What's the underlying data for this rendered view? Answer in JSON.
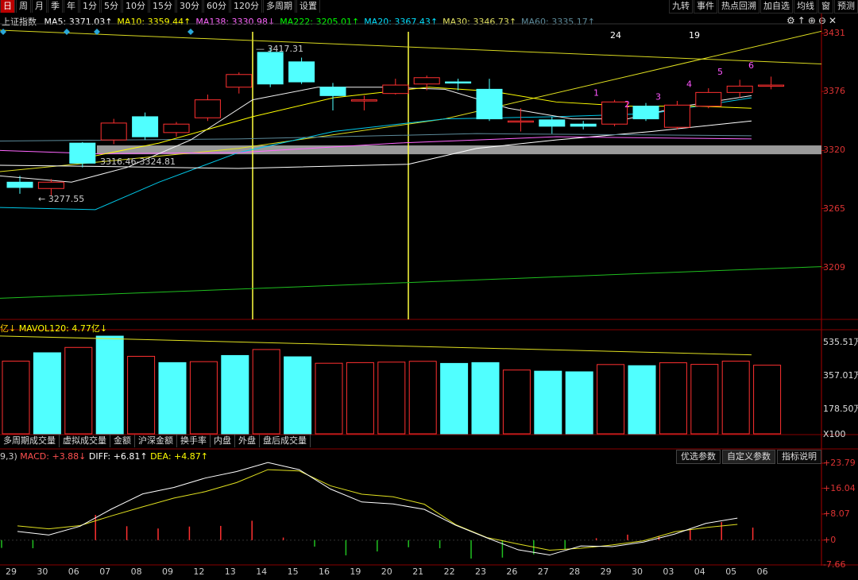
{
  "toolbar": {
    "periods": [
      "日",
      "周",
      "月",
      "季",
      "年",
      "1分",
      "5分",
      "10分",
      "15分",
      "30分",
      "60分",
      "120分",
      "多周期",
      "设置"
    ],
    "active_period": "日",
    "tools": [
      "九转",
      "事件",
      "热点回溯",
      "加自选",
      "均线",
      "窗",
      "预测"
    ]
  },
  "main_indicator": {
    "name": "上证指数",
    "items": [
      {
        "text": "MA5: 3371.03↑",
        "color": "#ffffff"
      },
      {
        "text": "MA10: 3359.44↑",
        "color": "#ffff00"
      },
      {
        "text": "MA138: 3330.98↓",
        "color": "#ff66ff"
      },
      {
        "text": "MA222: 3205.01↑",
        "color": "#00ff00"
      },
      {
        "text": "MA20: 3367.43↑",
        "color": "#00e0ff"
      },
      {
        "text": "MA30: 3346.73↑",
        "color": "#e0e060"
      },
      {
        "text": "MA60: 3335.17↑",
        "color": "#5c8a9a"
      }
    ],
    "icons": [
      "settings-icon",
      "arrow-up-icon",
      "zoom-in-icon",
      "zoom-out-icon",
      "close-icon"
    ]
  },
  "price_axis": [
    "3431",
    "3376",
    "3320",
    "3265",
    "3209"
  ],
  "annotations": {
    "high": "3417.31",
    "low": "3277.55",
    "range": "3316.46-3324.81",
    "count_24": "24",
    "count_19": "19",
    "nine_turn": [
      "1",
      "2",
      "3",
      "4",
      "5",
      "6"
    ]
  },
  "volume_indicator": {
    "prefix": "亿↓",
    "text": "MAVOL120: 4.77亿↓"
  },
  "volume_axis": [
    "535.51万",
    "357.01万",
    "178.50万",
    "X100"
  ],
  "volume_tabs": [
    "多周期成交量",
    "虚拟成交量",
    "金额",
    "沪深金额",
    "换手率",
    "内盘",
    "外盘",
    "盘后成交量"
  ],
  "macd_indicator": {
    "params": "9,3)",
    "macd": "MACD: +3.88↓",
    "diff": "DIFF: +6.81↑",
    "dea": "DEA: +4.87↑"
  },
  "macd_buttons": [
    "优选参数",
    "自定义参数",
    "指标说明"
  ],
  "macd_axis": [
    "+23.79",
    "+16.04",
    "+8.07",
    "+0",
    "-7.66"
  ],
  "dates": [
    "29",
    "30",
    "06",
    "07",
    "08",
    "09",
    "12",
    "13",
    "14",
    "15",
    "16",
    "19",
    "20",
    "21",
    "22",
    "23",
    "26",
    "27",
    "28",
    "29",
    "30",
    "03",
    "04",
    "05",
    "06"
  ],
  "chart_data": {
    "type": "candlestick",
    "candles": [
      {
        "date": "29",
        "open": 3290,
        "close": 3285,
        "high": 3296,
        "low": 3279
      },
      {
        "date": "30",
        "open": 3284,
        "close": 3290,
        "high": 3293,
        "low": 3277.55
      },
      {
        "date": "06",
        "open": 3327,
        "close": 3308,
        "high": 3328,
        "low": 3304
      },
      {
        "date": "07",
        "open": 3330,
        "close": 3346,
        "high": 3350,
        "low": 3326
      },
      {
        "date": "08",
        "open": 3352,
        "close": 3333,
        "high": 3356,
        "low": 3330
      },
      {
        "date": "09",
        "open": 3337,
        "close": 3345,
        "high": 3347,
        "low": 3333
      },
      {
        "date": "12",
        "open": 3351,
        "close": 3368,
        "high": 3373,
        "low": 3348
      },
      {
        "date": "13",
        "open": 3380,
        "close": 3392,
        "high": 3394,
        "low": 3374
      },
      {
        "date": "14",
        "open": 3413,
        "close": 3383,
        "high": 3417.31,
        "low": 3380
      },
      {
        "date": "15",
        "open": 3404,
        "close": 3385,
        "high": 3408,
        "low": 3383
      },
      {
        "date": "16",
        "open": 3380,
        "close": 3372,
        "high": 3384,
        "low": 3358
      },
      {
        "date": "19",
        "open": 3368,
        "close": 3368,
        "high": 3372,
        "low": 3358
      },
      {
        "date": "20",
        "open": 3374,
        "close": 3382,
        "high": 3388,
        "low": 3373
      },
      {
        "date": "21",
        "open": 3383,
        "close": 3389,
        "high": 3391,
        "low": 3377
      },
      {
        "date": "22",
        "open": 3385,
        "close": 3384,
        "high": 3388,
        "low": 3377
      },
      {
        "date": "23",
        "open": 3378,
        "close": 3350,
        "high": 3388,
        "low": 3348
      },
      {
        "date": "26",
        "open": 3348,
        "close": 3348,
        "high": 3360,
        "low": 3338
      },
      {
        "date": "27",
        "open": 3349,
        "close": 3343,
        "high": 3352,
        "low": 3336
      },
      {
        "date": "28",
        "open": 3345,
        "close": 3343,
        "high": 3348,
        "low": 3340
      },
      {
        "date": "29",
        "open": 3345,
        "close": 3366,
        "high": 3368,
        "low": 3343
      },
      {
        "date": "30",
        "open": 3362,
        "close": 3350,
        "high": 3365,
        "low": 3348
      },
      {
        "date": "03",
        "open": 3342,
        "close": 3363,
        "high": 3367,
        "low": 3340
      },
      {
        "date": "04",
        "open": 3362,
        "close": 3375,
        "high": 3379,
        "low": 3360
      },
      {
        "date": "05",
        "open": 3375,
        "close": 3381,
        "high": 3387,
        "low": 3370
      },
      {
        "date": "06",
        "open": 3381,
        "close": 3382,
        "high": 3390,
        "low": 3378
      }
    ],
    "price_range": [
      3160,
      3440
    ],
    "volumes": [
      4.5,
      5.02,
      5.35,
      6.05,
      4.8,
      4.41,
      4.47,
      4.85,
      5.22,
      4.77,
      4.37,
      4.41,
      4.44,
      4.49,
      4.36,
      4.41,
      3.95,
      3.88,
      3.84,
      4.29,
      4.22,
      4.4,
      4.3,
      4.5,
      4.25
    ],
    "volume_up": [
      true,
      false,
      true,
      false,
      true,
      false,
      true,
      false,
      true,
      false,
      true,
      true,
      true,
      true,
      false,
      false,
      true,
      false,
      false,
      true,
      false,
      true,
      true,
      true,
      true
    ],
    "volume_range": [
      0,
      6.2
    ],
    "mavol120": [
      6.06,
      4.89
    ],
    "macd_diff": [
      2.7,
      1.6,
      4.3,
      9.6,
      14.3,
      16.3,
      19.2,
      21.2,
      24.0,
      21.8,
      15.8,
      11.8,
      11.2,
      9.5,
      4.6,
      0.7,
      -3.0,
      -4.6,
      -1.8,
      -2.0,
      -0.6,
      1.9,
      5.2,
      6.81
    ],
    "macd_dea": [
      4.4,
      3.5,
      4.5,
      7.5,
      10.3,
      13.0,
      15.0,
      17.8,
      21.8,
      21.4,
      16.8,
      14.2,
      13.4,
      11.1,
      4.8,
      0.8,
      -1.2,
      -3.1,
      -2.5,
      -1.5,
      -0.2,
      2.6,
      3.9,
      4.87
    ],
    "macd_hist": [
      -2.4,
      -2.5,
      0.0,
      7.8,
      4.3,
      3.6,
      4.2,
      4.4,
      6.0,
      0.8,
      -2.0,
      -4.7,
      -3.5,
      -2.2,
      -2.5,
      -5.7,
      -5.4,
      -4.4,
      -2.9,
      0.6,
      1.7,
      1.3,
      3.5,
      5.6,
      3.88
    ],
    "macd_range": [
      -7.66,
      23.79
    ]
  }
}
